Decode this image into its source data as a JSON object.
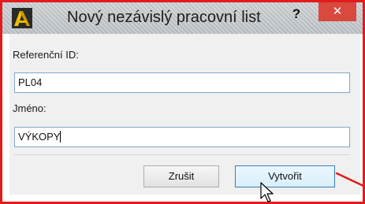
{
  "dialog": {
    "title": "Nový nezávislý pracovní list",
    "help_glyph": "?",
    "close_glyph": "✕"
  },
  "form": {
    "reference_id_label": "Referenční ID:",
    "reference_id_value": "PL04",
    "name_label": "Jméno:",
    "name_value": "VÝKOPY"
  },
  "buttons": {
    "cancel_label": "Zrušit",
    "create_label": "Vytvořit"
  },
  "colors": {
    "annotation_red": "#e21b1b",
    "close_button_bg": "#d9493e",
    "field_border": "#7fa7cc"
  },
  "icons": {
    "app": "archicad-logo-icon",
    "cursor": "mouse-pointer-icon",
    "annotation": "red-arrow-annotation"
  }
}
